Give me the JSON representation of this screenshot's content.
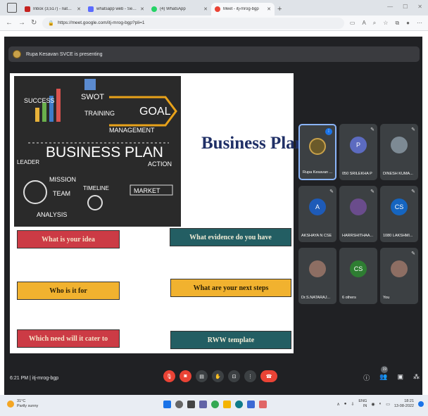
{
  "browser": {
    "tabs": [
      {
        "label": "Inbox (3,517) - nataraj@svce.ac.in",
        "favicon_color": "#c5221f",
        "active": false
      },
      {
        "label": "whatsapp web - Search",
        "favicon_color": "#5b6bff",
        "active": false
      },
      {
        "label": "(4) WhatsApp",
        "favicon_color": "#25d366",
        "active": false
      },
      {
        "label": "Meet - itj-mrog-bgp",
        "favicon_color": "#ea4335",
        "active": true
      }
    ],
    "new_tab": "+",
    "url": "https://meet.google.com/itj-mrog-bgp?pli=1"
  },
  "meet": {
    "presenting_banner": "Rupa Kesavan SVCE is presenting",
    "meeting_time": "6:21 PM",
    "meeting_code": "itj-mrog-bgp",
    "participant_badge": "19",
    "participants": [
      {
        "name": "Rupa Kesavan ...",
        "initials": "",
        "avatar_color": "#6b5a2a",
        "speaking": true
      },
      {
        "name": "050 SRILEKHA P",
        "initials": "P",
        "avatar_color": "#5c6bc0",
        "speaking": false
      },
      {
        "name": "DINESH KUMA...",
        "initials": "",
        "avatar_color": "#7d8a94",
        "speaking": false
      },
      {
        "name": "AKSHAYA N CSE",
        "initials": "A",
        "avatar_color": "#1e5bb8",
        "speaking": false
      },
      {
        "name": "HARRSHITHAA...",
        "initials": "",
        "avatar_color": "#6a4c8c",
        "speaking": false
      },
      {
        "name": "1080 LAKSHMI...",
        "initials": "CS",
        "avatar_color": "#1565c0",
        "speaking": false
      },
      {
        "name": "Dr.S.NATARAJ...",
        "initials": "",
        "avatar_color": "#8d6e63",
        "speaking": false
      },
      {
        "name": "6 others",
        "initials": "CS",
        "avatar_color": "#2e7d32",
        "speaking": false
      },
      {
        "name": "You",
        "initials": "",
        "avatar_color": "#8d6e63",
        "speaking": false
      }
    ]
  },
  "slide": {
    "title": "Business Plan",
    "image_words": {
      "success": "SUCCESS",
      "swot": "SWOT",
      "goal": "GOAL",
      "training": "TRAINING",
      "management": "MANAGEMENT",
      "business_plan": "BUSINESS PLAN",
      "leader": "LEADER",
      "action": "ACTION",
      "mission": "MISSION",
      "team": "TEAM",
      "timeline": "TIMELINE",
      "market": "MARKET",
      "analysis": "ANALYSIS"
    },
    "boxes": {
      "idea": "What is your idea",
      "evidence": "What evidence do you have",
      "who": "Who is it for",
      "next_steps": "What are your next steps",
      "need": "Which need will it cater to",
      "template": "RWW template"
    }
  },
  "taskbar": {
    "weather_temp": "31°C",
    "weather_desc": "Partly sunny",
    "lang": "ENG",
    "lang_region": "IN",
    "time": "18:21",
    "date": "13-08-2022"
  }
}
